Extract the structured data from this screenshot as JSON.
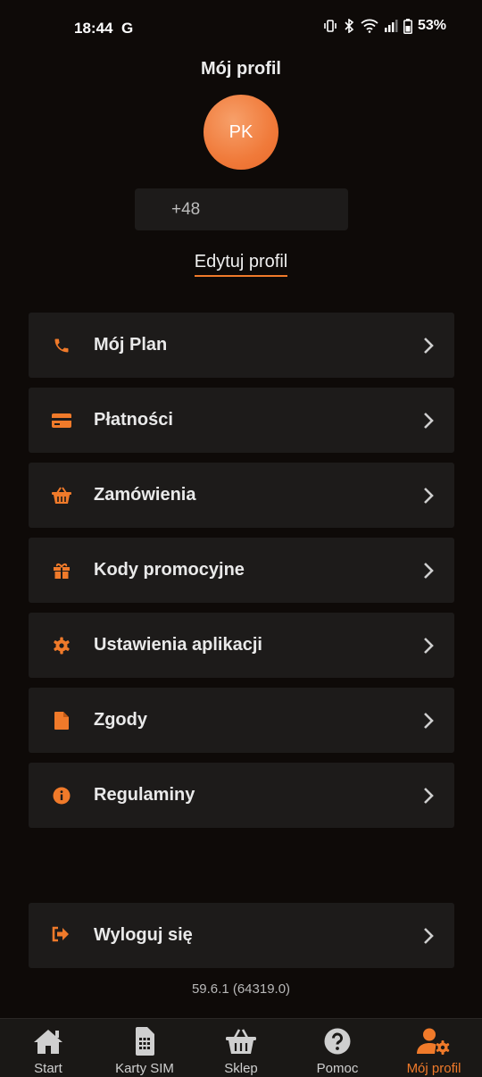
{
  "status_bar": {
    "time": "18:44",
    "carrier_icon": "G",
    "battery": "53%"
  },
  "header": {
    "title": "Mój profil",
    "avatar_initials": "PK",
    "phone": "+48",
    "edit_profile": "Edytuj profil"
  },
  "menu": {
    "items": [
      {
        "label": "Mój Plan",
        "icon": "phone-icon"
      },
      {
        "label": "Płatności",
        "icon": "credit-card-icon"
      },
      {
        "label": "Zamówienia",
        "icon": "basket-icon"
      },
      {
        "label": "Kody promocyjne",
        "icon": "gift-icon"
      },
      {
        "label": "Ustawienia aplikacji",
        "icon": "gear-icon"
      },
      {
        "label": "Zgody",
        "icon": "document-icon"
      },
      {
        "label": "Regulaminy",
        "icon": "info-icon"
      }
    ],
    "logout": {
      "label": "Wyloguj się",
      "icon": "logout-icon"
    }
  },
  "version": "59.6.1 (64319.0)",
  "bottom_nav": {
    "items": [
      {
        "label": "Start",
        "icon": "home-icon"
      },
      {
        "label": "Karty SIM",
        "icon": "sim-card-icon"
      },
      {
        "label": "Sklep",
        "icon": "basket-icon"
      },
      {
        "label": "Pomoc",
        "icon": "help-icon"
      },
      {
        "label": "Mój profil",
        "icon": "user-gear-icon",
        "active": true
      }
    ]
  },
  "colors": {
    "accent": "#f07a2a",
    "background": "#0e0a08",
    "card": "#1d1b1a"
  }
}
